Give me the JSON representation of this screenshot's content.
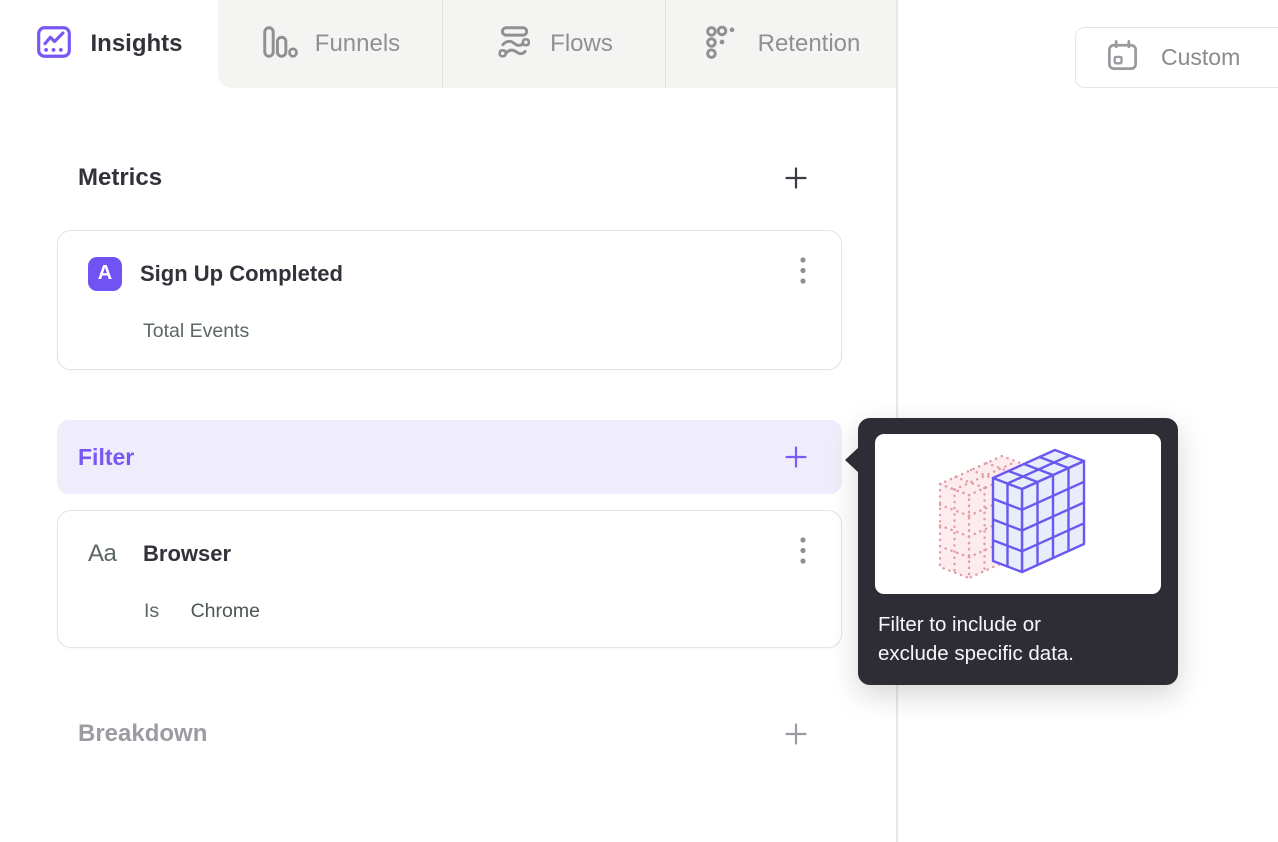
{
  "tabs": [
    {
      "label": "Insights",
      "icon": "insights-chart-icon",
      "active": true
    },
    {
      "label": "Funnels",
      "icon": "funnels-bars-icon",
      "active": false
    },
    {
      "label": "Flows",
      "icon": "flows-stream-icon",
      "active": false
    },
    {
      "label": "Retention",
      "icon": "retention-dots-icon",
      "active": false
    }
  ],
  "date_picker": {
    "label": "Custom",
    "icon": "calendar-icon"
  },
  "builder": {
    "metrics_section": {
      "title": "Metrics",
      "add_icon": "plus-icon"
    },
    "metric_card": {
      "badge": "A",
      "title": "Sign Up Completed",
      "subtitle": "Total Events",
      "menu_icon": "kebab-menu-icon"
    },
    "filter_section": {
      "title": "Filter",
      "add_icon": "plus-icon"
    },
    "filter_card": {
      "type_icon_label": "Aa",
      "title": "Browser",
      "operator": "Is",
      "value": "Chrome",
      "menu_icon": "kebab-menu-icon"
    },
    "breakdown_section": {
      "title": "Breakdown",
      "add_icon": "plus-icon"
    }
  },
  "tooltip": {
    "line1": "Filter to include or",
    "line2": "exclude specific data.",
    "illustration": "filter-cube-illustration"
  },
  "colors": {
    "accent_purple": "#7857f5",
    "badge_purple": "#7152f3",
    "filter_highlight_bg": "#efedfc",
    "tooltip_bg": "#2e2d36",
    "illustration_purple": "#6a58f0",
    "illustration_pink": "#e29aa4",
    "inactive_tab_bg": "#f4f4f2"
  }
}
